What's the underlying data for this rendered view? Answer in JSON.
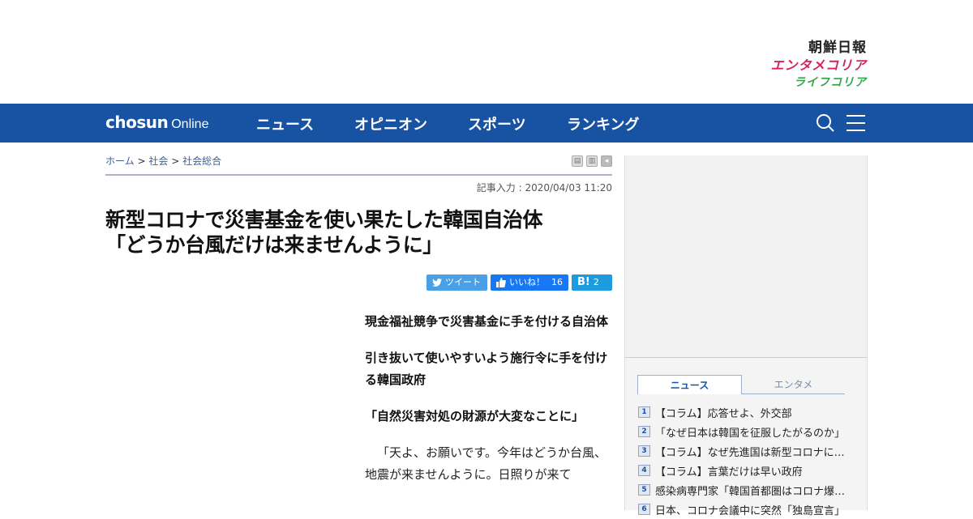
{
  "brands": {
    "chosun": "朝鮮日報",
    "entame": "エンタメコリア",
    "life": "ライフコリア"
  },
  "nav": {
    "logo_bold": "chosun",
    "logo_light": "Online",
    "items": [
      "ニュース",
      "オピニオン",
      "スポーツ",
      "ランキング"
    ],
    "icons": [
      "search-icon",
      "menu-icon"
    ],
    "bg_color": "#1852a3"
  },
  "breadcrumb": {
    "items": [
      "ホーム",
      "社会",
      "社会総合"
    ],
    "sep": ">"
  },
  "article": {
    "dateline": "記事入力 : 2020/04/03 11:20",
    "title_line1": "新型コロナで災害基金を使い果たした韓国自治体",
    "title_line2": "「どうか台風だけは来ませんように」",
    "subheads": [
      "現金福祉競争で災害基金に手を付ける自治体",
      "引き抜いて使いやすいよう施行令に手を付ける韓国政府",
      "「自然災害対処の財源が大変なことに」"
    ],
    "body": "「天よ、お願いです。今年はどうか台風、地震が来ませんように。日照りが来て"
  },
  "share": {
    "tweet_label": "ツイート",
    "like_label": "いいね！",
    "like_count": "16",
    "hatena_label": "B!",
    "hatena_count": "2"
  },
  "sidebar": {
    "tabs": [
      "ニュース",
      "エンタメ"
    ],
    "active_tab": "ニュース",
    "ranking": [
      {
        "num": "1",
        "title": "【コラム】応答せよ、外交部"
      },
      {
        "num": "2",
        "title": "「なぜ日本は韓国を征服したがるのか」"
      },
      {
        "num": "3",
        "title": "【コラム】なぜ先進国は新型コロナに…"
      },
      {
        "num": "4",
        "title": "【コラム】言葉だけは早い政府"
      },
      {
        "num": "5",
        "title": "感染病専門家「韓国首都圏はコロナ爆…"
      },
      {
        "num": "6",
        "title": "日本、コロナ会議中に突然「独島宣言」"
      }
    ]
  }
}
